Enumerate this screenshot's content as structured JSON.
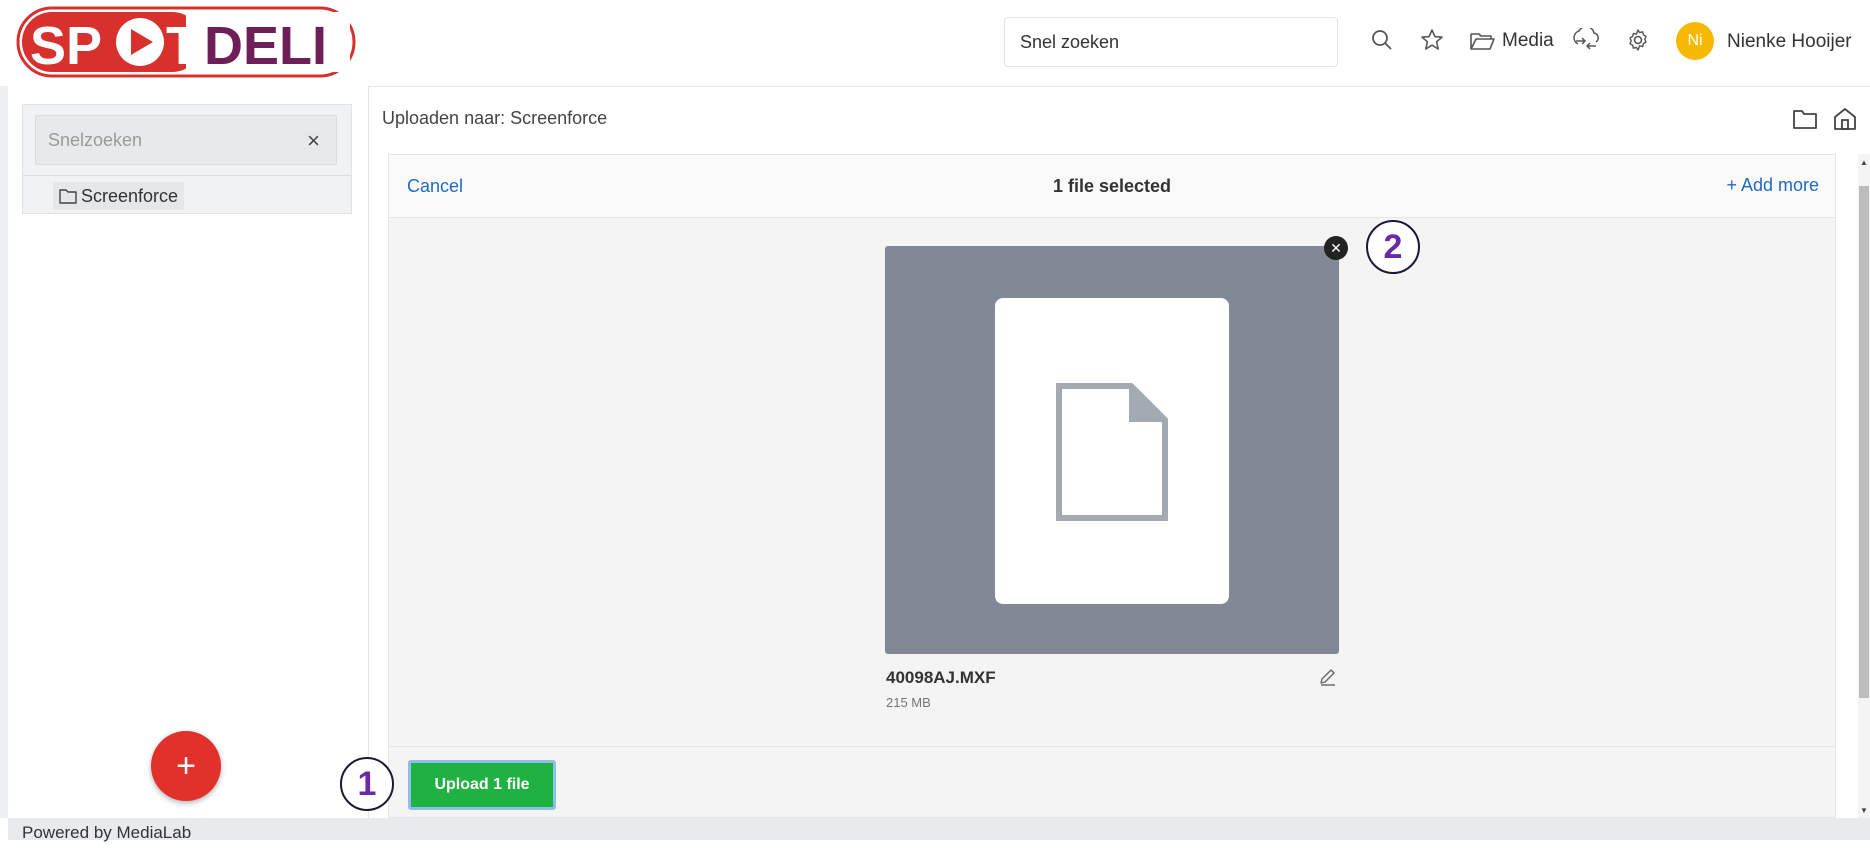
{
  "header": {
    "logo_text": "SPOTDELI",
    "search_value": "Snel zoeken",
    "media_label": "Media",
    "user_initials": "Ni",
    "user_name": "Nienke Hooijer"
  },
  "sidebar": {
    "search_placeholder": "Snelzoeken",
    "clear_symbol": "×",
    "tree": [
      {
        "label": "Screenforce"
      }
    ],
    "fab_symbol": "+"
  },
  "main": {
    "upload_path": "Uploaden naar: Screenforce",
    "dashboard": {
      "cancel_label": "Cancel",
      "selection_status": "1 file selected",
      "add_more_label": "+ Add more",
      "files": [
        {
          "name": "40098AJ.MXF",
          "size": "215 MB"
        }
      ],
      "remove_symbol": "✕"
    },
    "upload_button": "Upload 1 file",
    "step_badges": [
      "1",
      "2"
    ]
  },
  "footer": {
    "text": "Powered by MediaLab"
  },
  "colors": {
    "brand_red": "#e0312b",
    "brand_purple": "#6a2aa8",
    "upload_green": "#1fb141",
    "link_blue": "#1f69c6",
    "avatar_yellow": "#f6b800",
    "preview_gray": "#838897"
  }
}
